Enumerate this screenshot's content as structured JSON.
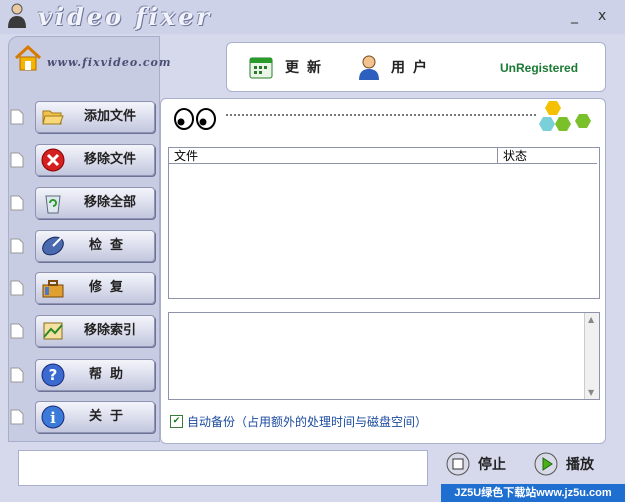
{
  "app": {
    "title": "video fixer",
    "url": "www.fixvideo.com"
  },
  "window_controls": {
    "minimize": "_",
    "close": "x"
  },
  "toolbar": {
    "update_label": "更新",
    "user_label": "用户",
    "status": "UnRegistered"
  },
  "sidebar": {
    "items": [
      {
        "label": "添加文件",
        "icon": "folder-open-icon"
      },
      {
        "label": "移除文件",
        "icon": "red-x-icon"
      },
      {
        "label": "移除全部",
        "icon": "recycle-bin-icon"
      },
      {
        "label": "检查",
        "icon": "satellite-dish-icon"
      },
      {
        "label": "修复",
        "icon": "toolbox-icon"
      },
      {
        "label": "移除索引",
        "icon": "index-icon"
      },
      {
        "label": "帮助",
        "icon": "help-icon"
      },
      {
        "label": "关于",
        "icon": "info-icon"
      }
    ]
  },
  "file_list": {
    "columns": [
      "文件",
      "状态"
    ],
    "rows": []
  },
  "options": {
    "auto_backup_label": "自动备份（占用额外的处理时间与磁盘空间）",
    "auto_backup_checked": true
  },
  "controls": {
    "stop_label": "停止",
    "play_label": "播放"
  },
  "watermark": "JZ5U绿色下载站www.jz5u.com",
  "colors": {
    "accent_green": "#1a7a33",
    "panel": "#d6d9ec",
    "link_blue": "#1a4a9e"
  }
}
